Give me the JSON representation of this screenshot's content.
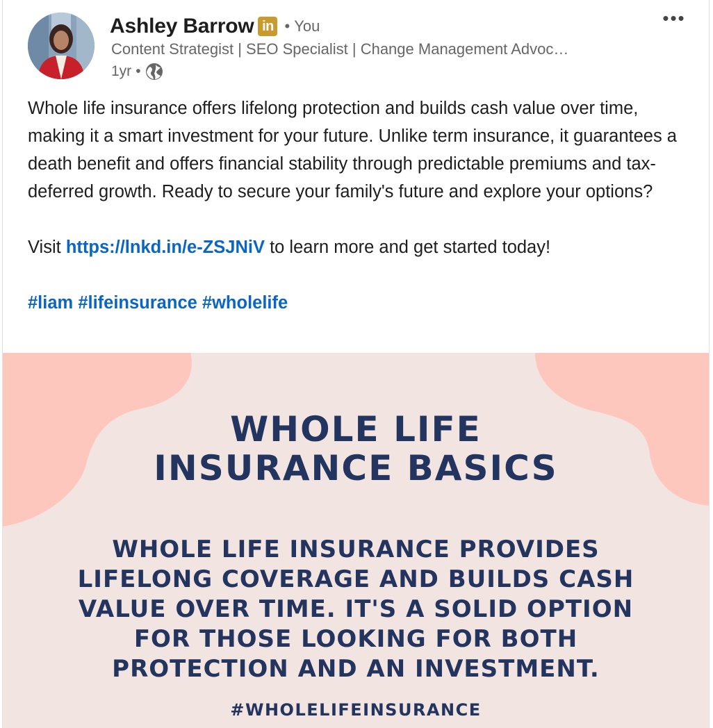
{
  "post": {
    "author": {
      "name": "Ashley Barrow",
      "badge": "in",
      "relation": "You",
      "headline": "Content Strategist | SEO Specialist | Change Management Advoc…",
      "time": "1yr",
      "visibility_icon": "globe-icon"
    },
    "menu_label": "•••",
    "body": {
      "paragraph1": "Whole life insurance offers lifelong protection and builds cash value over time, making it a smart investment for your future. Unlike term insurance, it guarantees a death benefit and offers financial stability through predictable premiums and tax-deferred growth. Ready to secure your family's future and explore your options?",
      "visit_prefix": "Visit ",
      "link": "https://lnkd.in/e-ZSJNiV",
      "visit_suffix": " to learn more and get started today!",
      "hashtags": [
        "#liam",
        "#lifeinsurance",
        "#wholelife"
      ]
    },
    "media": {
      "title_line1": "WHOLE LIFE",
      "title_line2": "INSURANCE BASICS",
      "body_lines": [
        "WHOLE LIFE INSURANCE PROVIDES",
        "LIFELONG COVERAGE AND BUILDS CASH",
        "VALUE OVER TIME. IT'S A SOLID OPTION",
        "FOR THOSE LOOKING FOR BOTH",
        "PROTECTION AND AN INVESTMENT."
      ],
      "hashtag": "#WHOLELIFEINSURANCE"
    }
  },
  "colors": {
    "link": "#0a66c2",
    "badge": "#c99a2e",
    "media_background": "#f1e4e1",
    "media_blob": "#fdc7bd",
    "media_text": "#23345e"
  }
}
